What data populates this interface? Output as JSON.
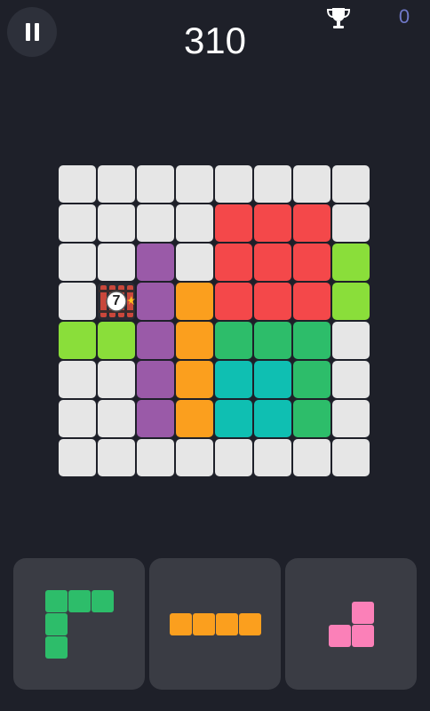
{
  "score": "310",
  "best_score": "0",
  "colors": {
    "empty": "#e6e6e6",
    "red": "#f4484a",
    "purple": "#9a5aa8",
    "orange": "#fb9f1e",
    "green": "#2dbd6a",
    "lime": "#8ade3a",
    "teal": "#0fbfb2",
    "pink": "#fb80b8"
  },
  "icons": {
    "pause": "pause-icon",
    "trophy": "trophy-icon",
    "bomb": "bomb-icon"
  },
  "board": {
    "rows": 8,
    "cols": 8,
    "grid": [
      [
        "empty",
        "empty",
        "empty",
        "empty",
        "empty",
        "empty",
        "empty",
        "empty"
      ],
      [
        "empty",
        "empty",
        "empty",
        "empty",
        "red",
        "red",
        "red",
        "empty"
      ],
      [
        "empty",
        "empty",
        "purple",
        "empty",
        "red",
        "red",
        "red",
        "lime"
      ],
      [
        "empty",
        "bomb",
        "purple",
        "orange",
        "red",
        "red",
        "red",
        "lime"
      ],
      [
        "lime",
        "lime",
        "purple",
        "orange",
        "green",
        "green",
        "green",
        "empty"
      ],
      [
        "empty",
        "empty",
        "purple",
        "orange",
        "teal",
        "teal",
        "green",
        "empty"
      ],
      [
        "empty",
        "empty",
        "purple",
        "orange",
        "teal",
        "teal",
        "green",
        "empty"
      ],
      [
        "empty",
        "empty",
        "empty",
        "empty",
        "empty",
        "empty",
        "empty",
        "empty"
      ]
    ],
    "bomb_counter": "7"
  },
  "pieces": [
    {
      "color": "green",
      "cells": [
        [
          0,
          0
        ],
        [
          0,
          1
        ],
        [
          0,
          2
        ],
        [
          1,
          0
        ],
        [
          2,
          0
        ]
      ]
    },
    {
      "color": "orange",
      "cells": [
        [
          0,
          0
        ],
        [
          0,
          1
        ],
        [
          0,
          2
        ],
        [
          0,
          3
        ]
      ]
    },
    {
      "color": "pink",
      "cells": [
        [
          0,
          1
        ],
        [
          1,
          0
        ],
        [
          1,
          1
        ]
      ]
    }
  ]
}
